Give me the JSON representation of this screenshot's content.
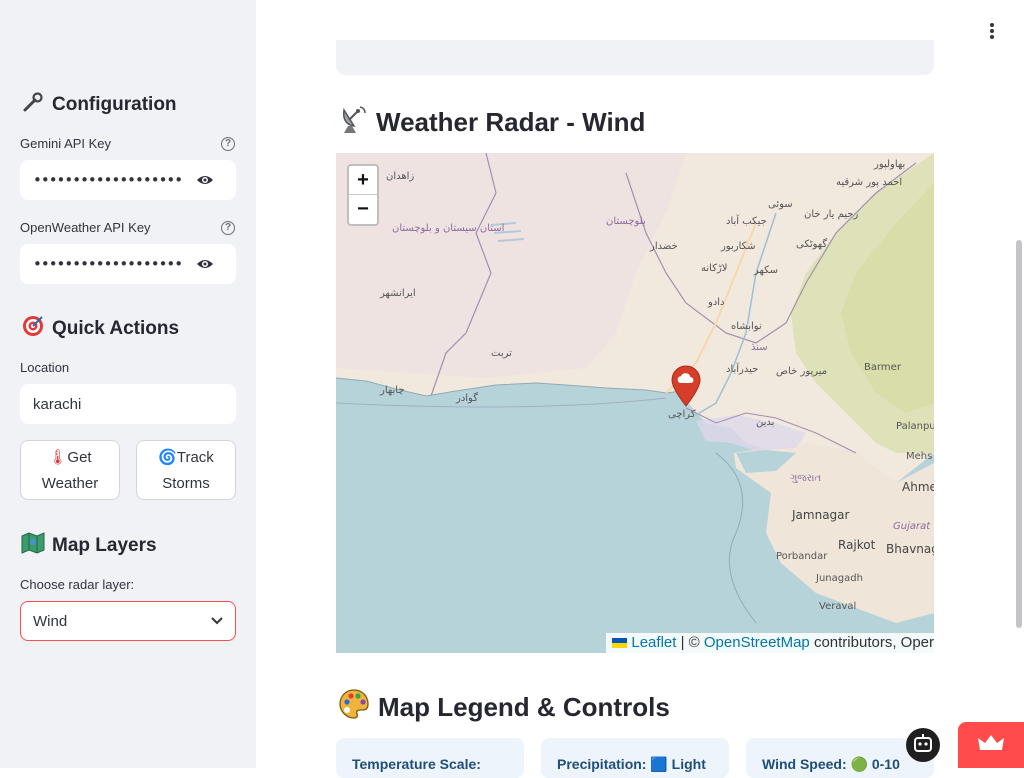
{
  "sidebar": {
    "configuration_heading": "Configuration",
    "configuration_icon": "wrench-icon",
    "gemini_label": "Gemini API Key",
    "gemini_value": "••••••••••••••••••••••••••••••••",
    "openweather_label": "OpenWeather API Key",
    "openweather_value": "••••••••••••••••••••••••••••••••",
    "quick_actions_heading": "Quick Actions",
    "quick_actions_icon": "target-icon",
    "location_label": "Location",
    "location_value": "karachi",
    "get_weather_line1": "Get",
    "get_weather_line2": "Weather",
    "get_weather_icon": "thermometer-icon",
    "track_storms_line1": "Track",
    "track_storms_line2": "Storms",
    "track_storms_icon": "cyclone-icon",
    "map_layers_heading": "Map Layers",
    "map_layers_icon": "map-icon",
    "radar_layer_label": "Choose radar layer:",
    "radar_layer_value": "Wind"
  },
  "main": {
    "radar_title": "Weather Radar - Wind",
    "radar_icon": "satellite-dish-icon",
    "legend_title": "Map Legend & Controls",
    "legend_icon": "palette-icon",
    "legend_cards": [
      {
        "label": "Temperature Scale:"
      },
      {
        "label": "Precipitation: 🟦 Light"
      },
      {
        "label": "Wind Speed: 🟢 0-10"
      }
    ]
  },
  "map": {
    "zoom_in": "+",
    "zoom_out": "−",
    "attribution_leaflet": "Leaflet",
    "attribution_sep": " | © ",
    "attribution_osm": "OpenStreetMap",
    "attribution_rest": " contributors, Oper",
    "marker_icon": "cloud-marker-icon",
    "places": [
      "زاهدان",
      "بلوچستان",
      "استان سیستان و بلوچستان",
      "ایرانشهر",
      "تربت",
      "چابهار",
      "گوادر",
      "خضدار",
      "جيكب آباد",
      "شكاربور",
      "لاڑكانه",
      "سکھر",
      "دادو",
      "نوابشاه",
      "سنڌ",
      "حيدرآباد",
      "ميرپور خاص",
      "كراچى",
      "بدين",
      "بهاولپور",
      "احمد پور شرقيه",
      "رحيم يار خان",
      "سوئی",
      "گهوٹکی",
      "Barmer",
      "Palanpur",
      "Mehs",
      "Ahme",
      "Jamnagar",
      "Rajkot",
      "Bhavnag",
      "Gujarat",
      "Porbandar",
      "Junagadh",
      "Veraval",
      "ગુજરાત"
    ]
  },
  "colors": {
    "accent": "#ff4b4b",
    "sidebar_bg": "#f0f2f6",
    "link": "#0078a8"
  }
}
